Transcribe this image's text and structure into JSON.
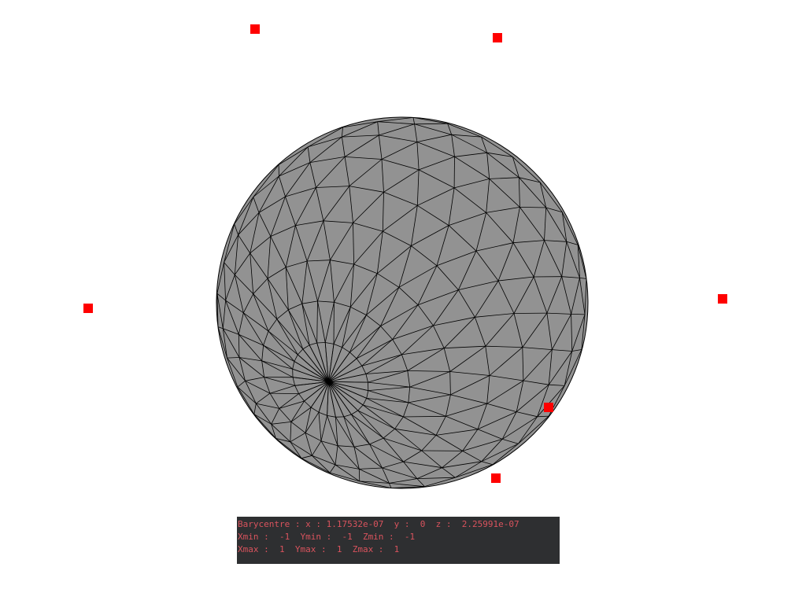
{
  "viewer": {
    "background_color": "#ffffff",
    "mesh": {
      "shape": "sphere",
      "fill_color": "#929292",
      "edge_color": "#000000"
    },
    "markers": {
      "count": 6,
      "color": "#ff0000"
    }
  },
  "info_panel": {
    "background_color": "#2e2f31",
    "text_color": "#d9535d",
    "lines": [
      "Barycentre : x : 1.17532e-07  y :  0  z :  2.25991e-07",
      "Xmin :  -1  Ymin :  -1  Zmin :  -1",
      "Xmax :  1  Ymax :  1  Zmax :  1"
    ]
  }
}
